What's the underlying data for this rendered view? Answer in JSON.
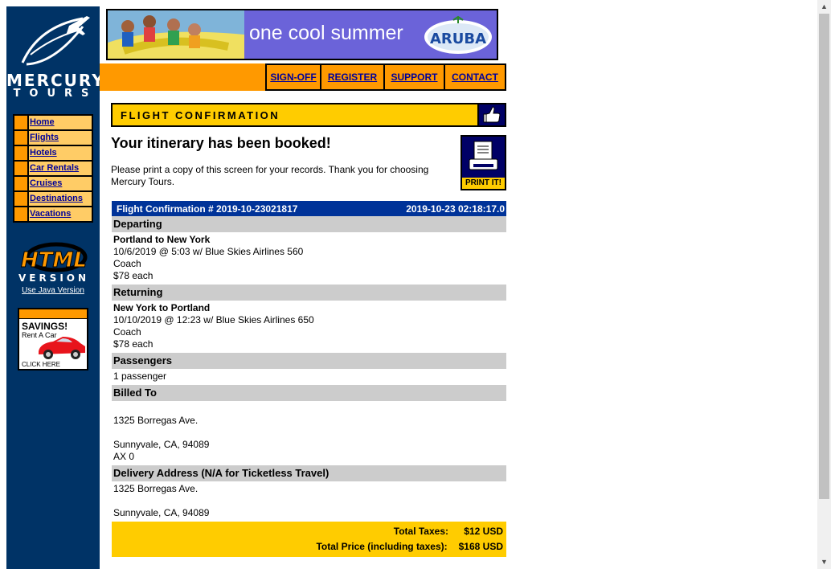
{
  "brand": {
    "line1": "MERCURY",
    "line2": "TOURS"
  },
  "sidebar": {
    "items": [
      {
        "label": "Home"
      },
      {
        "label": "Flights"
      },
      {
        "label": "Hotels"
      },
      {
        "label": "Car Rentals"
      },
      {
        "label": "Cruises"
      },
      {
        "label": "Destinations"
      },
      {
        "label": "Vacations"
      }
    ],
    "html_version": {
      "line1": "HTML",
      "line2": "VERSION"
    },
    "java_link": "Use Java Version",
    "ad": {
      "savings": "SAVINGS!",
      "rent": "Rent A Car",
      "click": "CLICK HERE"
    }
  },
  "banner": {
    "text": "one cool summer",
    "logo": "ARUBA"
  },
  "topnav": {
    "items": [
      {
        "label": "SIGN-OFF"
      },
      {
        "label": "REGISTER"
      },
      {
        "label": "SUPPORT"
      },
      {
        "label": "CONTACT"
      }
    ]
  },
  "confirmation": {
    "header": "FLIGHT CONFIRMATION",
    "title": "Your itinerary has been booked!",
    "message": "Please print a copy of this screen for your records. Thank you for choosing Mercury Tours.",
    "print_label": "PRINT IT!",
    "number_label": "Flight Confirmation # 2019-10-23021817",
    "timestamp": "2019-10-23 02:18:17.0",
    "departing": {
      "heading": "Departing",
      "route": "Portland to New York",
      "details": "10/6/2019 @ 5:03 w/ Blue Skies Airlines 560",
      "class": "Coach",
      "price": "$78 each"
    },
    "returning": {
      "heading": "Returning",
      "route": "New York to Portland",
      "details": "10/10/2019 @ 12:23 w/ Blue Skies Airlines 650",
      "class": "Coach",
      "price": "$78 each"
    },
    "passengers": {
      "heading": "Passengers",
      "value": "1 passenger"
    },
    "billed_to": {
      "heading": "Billed To",
      "address1": "1325 Borregas Ave.",
      "address2": "Sunnyvale, CA, 94089",
      "card": "AX 0"
    },
    "delivery": {
      "heading": "Delivery Address (N/A for Ticketless Travel)",
      "address1": "1325 Borregas Ave.",
      "address2": "Sunnyvale, CA, 94089"
    },
    "totals": {
      "taxes_label": "Total Taxes:",
      "taxes_value": "$12 USD",
      "price_label": "Total Price (including taxes):",
      "price_value": "$168 USD"
    }
  },
  "colors": {
    "sidebar_bg": "#003366",
    "accent_orange": "#ff9900",
    "accent_yellow": "#ffcc00",
    "link_blue": "#000099",
    "table_header": "#003399",
    "section_gray": "#cccccc"
  }
}
